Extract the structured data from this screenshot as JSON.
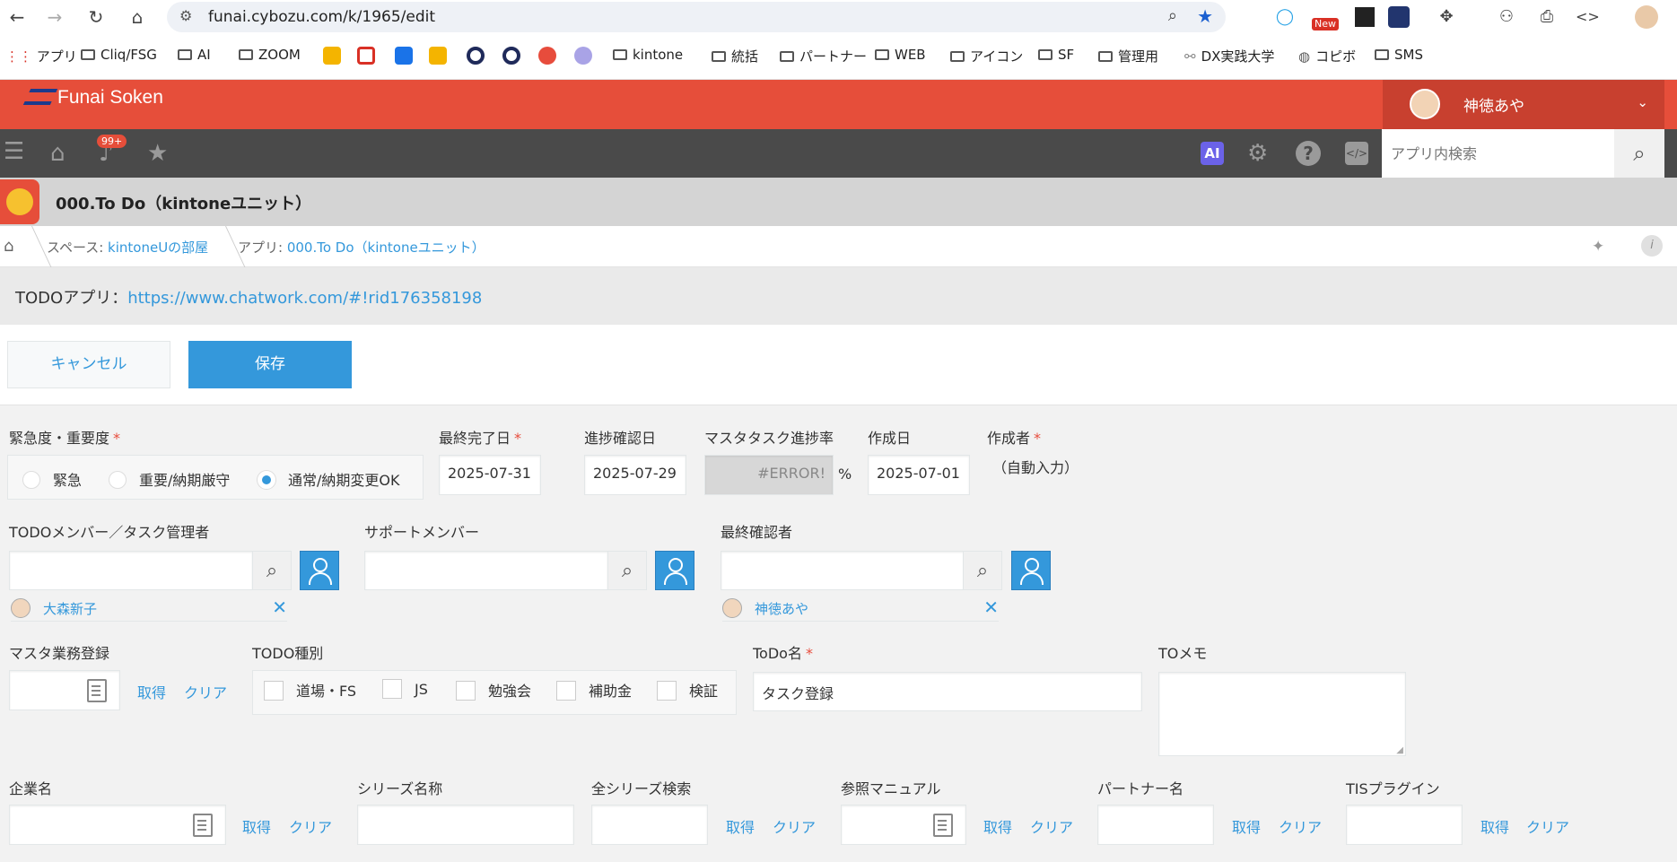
{
  "browser": {
    "url": "funai.cybozu.com/k/1965/edit",
    "ext_new_badge": "New",
    "bookmarks": [
      "アプリ",
      "Cliq/FSG",
      "AI",
      "ZOOM",
      "kintone",
      "統括",
      "パートナー",
      "WEB",
      "アイコン",
      "SF",
      "管理用",
      "DX実践大学",
      "コピボ",
      "SMS"
    ]
  },
  "header": {
    "logo": "Funai Soken",
    "user_name": "神徳あや",
    "notification_count": "99+",
    "ai_label": "AI",
    "search_placeholder": "アプリ内検索"
  },
  "app": {
    "title": "000.To Do（kintoneユニット）",
    "breadcrumb": {
      "space_prefix": "スペース:",
      "space_name": "kintoneUの部屋",
      "app_prefix": "アプリ:",
      "app_name": "000.To Do（kintoneユニット）"
    },
    "notice_text": "TODOアプリ：",
    "notice_link": "https://www.chatwork.com/#!rid176358198"
  },
  "actions": {
    "cancel": "キャンセル",
    "save": "保存"
  },
  "form": {
    "urgency": {
      "label": "緊急度・重要度",
      "options": [
        "緊急",
        "重要/納期厳守",
        "通常/納期変更OK"
      ],
      "selected": "通常/納期変更OK"
    },
    "final_due": {
      "label": "最終完了日",
      "value": "2025-07-31"
    },
    "progress_check": {
      "label": "進捗確認日",
      "value": "2025-07-29"
    },
    "master_progress": {
      "label": "マスタタスク進捗率",
      "value": "#ERROR!",
      "unit": "%"
    },
    "created_date": {
      "label": "作成日",
      "value": "2025-07-01"
    },
    "creator": {
      "label": "作成者",
      "value": "（自動入力）"
    },
    "todo_member": {
      "label": "TODOメンバー／タスク管理者",
      "user": "大森新子"
    },
    "support_member": {
      "label": "サポートメンバー"
    },
    "final_checker": {
      "label": "最終確認者",
      "user": "神徳あや"
    },
    "master_registration": {
      "label": "マスタ業務登録",
      "fetch": "取得",
      "clear": "クリア"
    },
    "todo_type": {
      "label": "TODO種別",
      "options": [
        "道場・FS",
        "JS",
        "勉強会",
        "補助金",
        "検証"
      ]
    },
    "todo_name": {
      "label": "ToDo名",
      "value": "タスク登録"
    },
    "to_memo": {
      "label": "TOメモ"
    },
    "company": {
      "label": "企業名",
      "fetch": "取得",
      "clear": "クリア"
    },
    "series_name": {
      "label": "シリーズ名称"
    },
    "all_series_search": {
      "label": "全シリーズ検索",
      "fetch": "取得",
      "clear": "クリア"
    },
    "manual": {
      "label": "参照マニュアル",
      "fetch": "取得",
      "clear": "クリア"
    },
    "partner": {
      "label": "パートナー名",
      "fetch": "取得",
      "clear": "クリア"
    },
    "tis_plugin": {
      "label": "TISプラグイン",
      "fetch": "取得",
      "clear": "クリア"
    }
  }
}
